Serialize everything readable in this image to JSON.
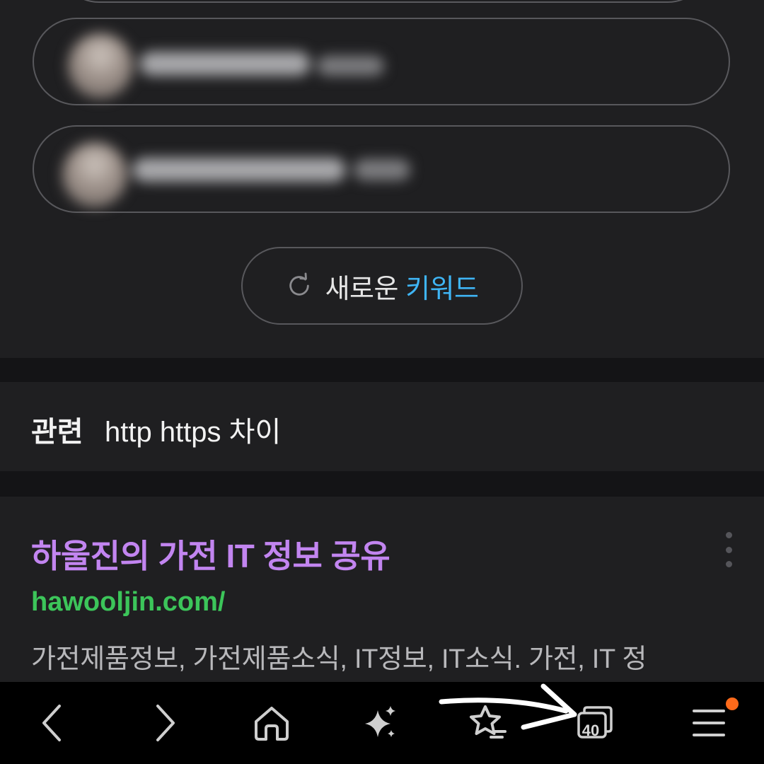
{
  "new_keyword_button": {
    "icon": "refresh-icon",
    "label_plain": "새로운",
    "label_highlight": "키워드"
  },
  "related": {
    "label": "관련",
    "query": "http https 차이"
  },
  "result": {
    "title": "하울진의 가전 IT 정보 공유",
    "url": "hawooljin.com/",
    "description": "가전제품정보, 가전제품소식, IT정보, IT소식. 가전, IT 정"
  },
  "bottom_nav": {
    "tab_count": "40",
    "items": [
      "back-icon",
      "forward-icon",
      "home-icon",
      "sparkle-icon",
      "bookmark-star-icon",
      "tabs-icon",
      "menu-icon"
    ]
  },
  "colors": {
    "highlight_blue": "#3fb5f5",
    "title_purple": "#c285f0",
    "url_green": "#3cc55a",
    "notification": "#ff6a1a"
  }
}
